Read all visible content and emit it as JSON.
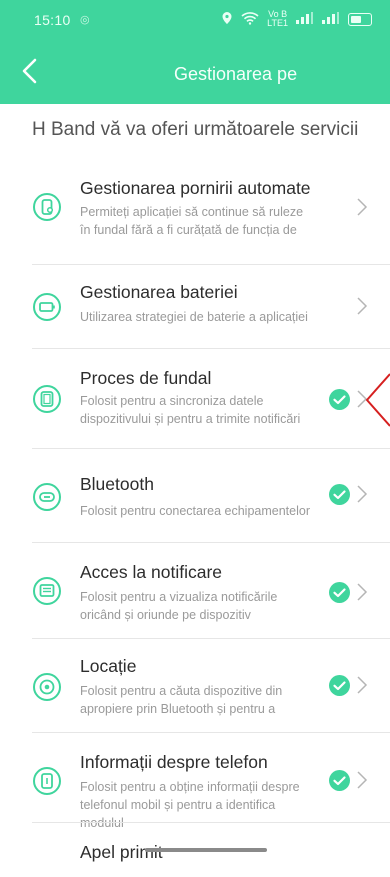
{
  "status_bar": {
    "time": "15:10",
    "network_label_top": "Vo B",
    "network_label_bottom": "LTE1",
    "accent": "#eafff5"
  },
  "header": {
    "title": "Gestionarea pe",
    "background": "#3fd59d"
  },
  "intro_text": "H Band vă va oferi următoarele servicii",
  "items": [
    {
      "title": "Gestionarea pornirii automate",
      "description": "Permiteți aplicației să continue să ruleze în fundal fără a fi curățată de funcția de",
      "icon": "phone-icon",
      "checked": false
    },
    {
      "title": "Gestionarea bateriei",
      "description": "Utilizarea strategiei de baterie a aplicației",
      "icon": "battery-icon",
      "checked": false
    },
    {
      "title": "Proces de fundal",
      "description": "Folosit pentru a sincroniza datele dispozitivului și pentru a trimite notificări",
      "icon": "background-process-icon",
      "checked": true
    },
    {
      "title": "Bluetooth",
      "description": "Folosit pentru conectarea echipamentelor",
      "icon": "bluetooth-icon",
      "checked": true
    },
    {
      "title": "Acces la notificare",
      "description": "Folosit pentru a vizualiza notificările oricând și oriunde pe dispozitiv",
      "icon": "notification-icon",
      "checked": true
    },
    {
      "title": "Locație",
      "description": "Folosit pentru a căuta dispozitive din apropiere prin Bluetooth și pentru a",
      "icon": "location-icon",
      "checked": true
    },
    {
      "title": "Informații despre telefon",
      "description": "Folosit pentru a obține informații despre telefonul mobil și pentru a identifica modulul",
      "icon": "phone-info-icon",
      "checked": true
    },
    {
      "title": "Apel primit",
      "description": "",
      "icon": "",
      "checked": false
    }
  ],
  "colors": {
    "accent_green": "#3fd59d",
    "annotation_red": "#d62020"
  }
}
